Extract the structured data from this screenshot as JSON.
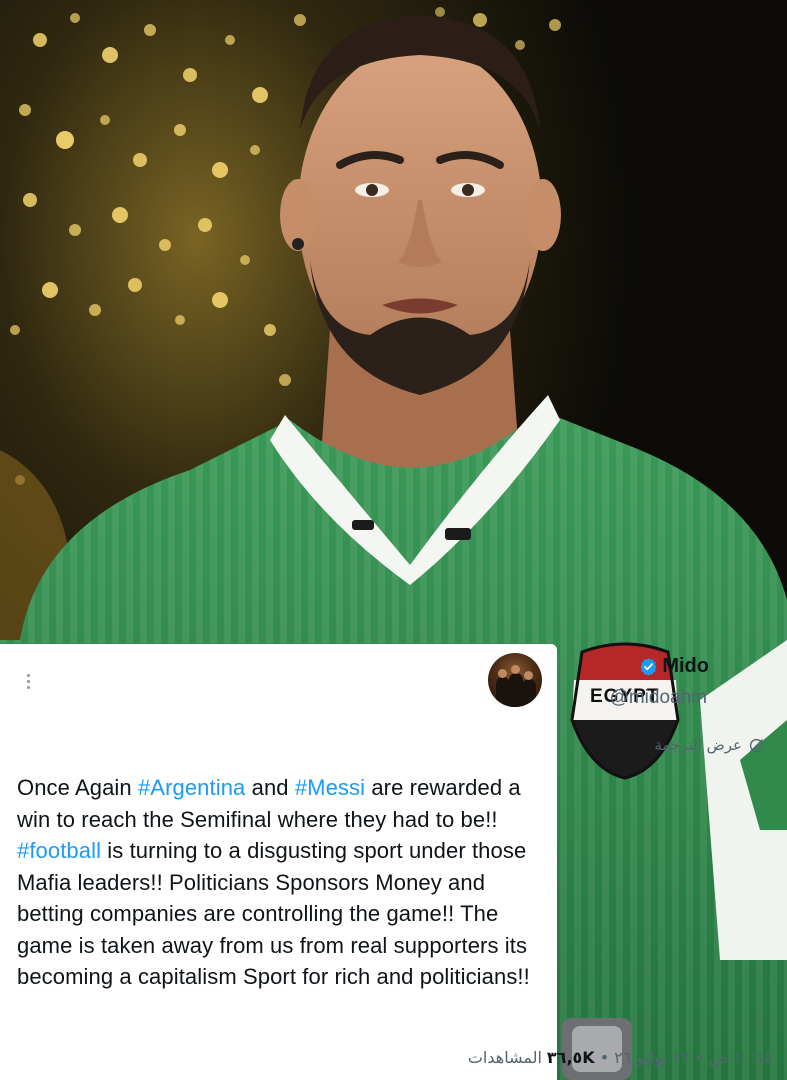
{
  "photo": {
    "jersey_badge_text": "EGYPT",
    "colors": {
      "jersey_green": "#2f8a4c",
      "background": "#0c0b07",
      "lights": "#e8c25a"
    }
  },
  "tweet": {
    "display_name": "Mido",
    "handle": "@midoahm",
    "verified": true,
    "translate_label": "عرض الترجمة",
    "text_segments": [
      {
        "text": "Once Again ",
        "type": "text"
      },
      {
        "text": "#Argentina",
        "type": "hashtag"
      },
      {
        "text": " and ",
        "type": "text"
      },
      {
        "text": "#Messi",
        "type": "hashtag"
      },
      {
        "text": " are rewarded a win to reach the Semifinal where they had to be!! ",
        "type": "text"
      },
      {
        "text": "#football",
        "type": "hashtag"
      },
      {
        "text": " is turning to a disgusting sport under those Mafia leaders!! Politicians Sponsors Money and betting companies are controlling the game!! The game is taken away from us from real supporters its becoming a capitalism Sport for rich and politicians!!",
        "type": "text"
      }
    ],
    "time": "١٠:١٤ ص",
    "separator": "•",
    "date": "١٢ يوليو ٢٦",
    "views_count": "٣٦,٥K",
    "views_label": "المشاهدات",
    "colors": {
      "hashtag": "#1d9bf0",
      "verified": "#1d9bf0",
      "text": "#0f1419",
      "secondary": "#536471"
    }
  }
}
